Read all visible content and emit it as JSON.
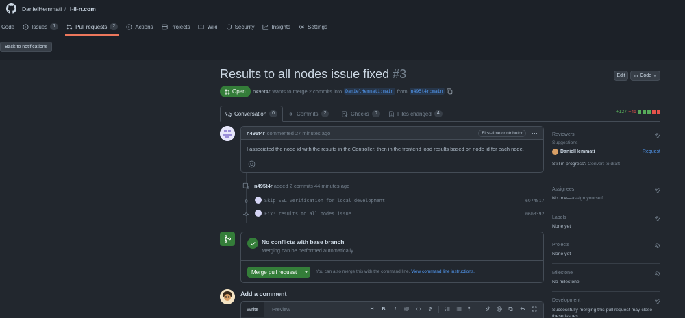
{
  "repo": {
    "owner": "DanielHemmati",
    "separator": "/",
    "name": "l-8-n.com"
  },
  "nav": [
    {
      "label": "Code",
      "icon": "code-icon"
    },
    {
      "label": "Issues",
      "count": "1",
      "icon": "issue-opened-icon"
    },
    {
      "label": "Pull requests",
      "count": "2",
      "icon": "git-pull-request-icon",
      "active": true
    },
    {
      "label": "Actions",
      "icon": "play-icon"
    },
    {
      "label": "Projects",
      "icon": "table-icon"
    },
    {
      "label": "Wiki",
      "icon": "book-icon"
    },
    {
      "label": "Security",
      "icon": "shield-icon"
    },
    {
      "label": "Insights",
      "icon": "graph-icon"
    },
    {
      "label": "Settings",
      "icon": "gear-icon"
    }
  ],
  "back_button": "Back to notifications",
  "pr": {
    "title": "Results to all nodes issue fixed",
    "number": "#3",
    "edit_label": "Edit",
    "code_label": "Code",
    "state": "Open",
    "author": "n495t4r",
    "meta_text": "wants to merge 2 commits into",
    "base_branch": "DanielHemmati:main",
    "from_text": "from",
    "head_branch": "n495t4r:main"
  },
  "tabs": [
    {
      "label": "Conversation",
      "count": "0",
      "active": true
    },
    {
      "label": "Commits",
      "count": "2"
    },
    {
      "label": "Checks",
      "count": "0"
    },
    {
      "label": "Files changed",
      "count": "4"
    }
  ],
  "diffstat": {
    "additions": "+127",
    "deletions": "−45"
  },
  "comment": {
    "author": "n495t4r",
    "time": "commented 27 minutes ago",
    "badge": "First-time contributor",
    "body": "I associated the node id with the results in the Controller, then in the frontend load results based on node id for each node."
  },
  "commits_event": {
    "author": "n495t4r",
    "text": "added 2 commits 44 minutes ago",
    "commits": [
      {
        "message": "Skip SSL verification for local development",
        "sha": "6974817"
      },
      {
        "message": "Fix: results to all nodes issue",
        "sha": "06b3392"
      }
    ]
  },
  "merge": {
    "title": "No conflicts with base branch",
    "subtitle": "Merging can be performed automatically.",
    "button": "Merge pull request",
    "hint": "You can also merge this with the command line.",
    "hint_link": "View command line instructions."
  },
  "add_comment": {
    "title": "Add a comment",
    "write_tab": "Write",
    "preview_tab": "Preview",
    "toolbar": [
      "H",
      "B",
      "I"
    ]
  },
  "sidebar": {
    "reviewers": {
      "title": "Reviewers",
      "suggestions": "Suggestions",
      "user": "DanielHemmati",
      "request": "Request",
      "progress": "Still in progress?",
      "convert": "Convert to draft"
    },
    "assignees": {
      "title": "Assignees",
      "value": "No one—",
      "action": "assign yourself"
    },
    "labels": {
      "title": "Labels",
      "value": "None yet"
    },
    "projects": {
      "title": "Projects",
      "value": "None yet"
    },
    "milestone": {
      "title": "Milestone",
      "value": "No milestone"
    },
    "development": {
      "title": "Development",
      "value": "Successfully merging this pull request may close these issues."
    }
  },
  "colors": {
    "accent": "#ec775c",
    "green": "#347d39",
    "link": "#539bf5",
    "bg": "#22272e"
  }
}
